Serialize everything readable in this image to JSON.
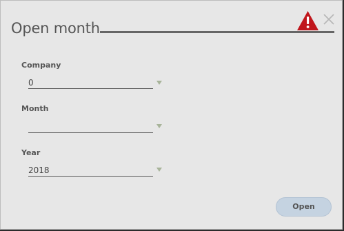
{
  "dialog": {
    "title": "Open month"
  },
  "fields": {
    "company": {
      "label": "Company",
      "value": "0"
    },
    "month": {
      "label": "Month",
      "value": ""
    },
    "year": {
      "label": "Year",
      "value": "2018"
    }
  },
  "buttons": {
    "open_label": "Open"
  },
  "icons": {
    "warning": "warning-triangle-icon",
    "close": "close-icon",
    "dropdown": "dropdown-arrow-icon"
  },
  "colors": {
    "background": "#e7e7e7",
    "warning": "#c0161c",
    "button": "#c5d3e1",
    "text": "#555555"
  }
}
